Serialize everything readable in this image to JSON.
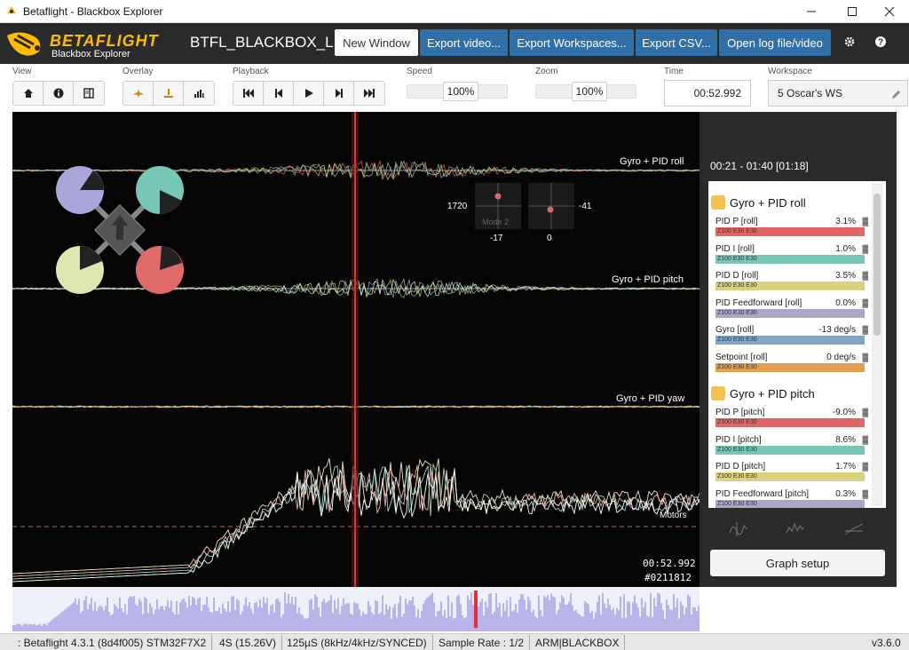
{
  "window": {
    "title": "Betaflight - Blackbox Explorer"
  },
  "brand": {
    "logo_text": "BETAFLIGHT",
    "logo_sub": "Blackbox Explorer",
    "accent": "#ffbb00"
  },
  "file": {
    "name": "BTFL_BLACKBOX_LO"
  },
  "header_buttons": [
    "New Window",
    "Export video...",
    "Export Workspaces...",
    "Export CSV...",
    "Open log file/video"
  ],
  "toolbar": {
    "view_label": "View",
    "overlay_label": "Overlay",
    "playback_label": "Playback",
    "speed_label": "Speed",
    "speed_value": "100%",
    "zoom_label": "Zoom",
    "zoom_value": "100%",
    "time_label": "Time",
    "time_value": "00:52.992",
    "workspace_label": "Workspace",
    "workspace_value": "5 Oscar's WS"
  },
  "graph": {
    "labels": [
      "Gyro + PID roll",
      "Gyro + PID pitch",
      "Gyro + PID yaw",
      "Motors"
    ],
    "sticks": {
      "left_x": "1720",
      "left_y": "-17",
      "right_x": "-41",
      "right_y": "0",
      "mode": "Mode 2"
    },
    "time": "00:52.992",
    "frame": "#0211812",
    "colors": {
      "roll": "#e06666",
      "pitch": "#76c7b7",
      "yaw": "#d9d17e",
      "setpoint": "#e0a050"
    }
  },
  "rightpanel": {
    "range": "00:21 - 01:40 [01:18]",
    "groups": [
      {
        "title": "Gyro + PID roll",
        "rows": [
          {
            "name": "PID P [roll]",
            "value": "3.1%",
            "bar": "Z100 E30 E30",
            "color": "#e06666"
          },
          {
            "name": "PID I [roll]",
            "value": "1.0%",
            "bar": "Z100 E30 E30",
            "color": "#76c7b7"
          },
          {
            "name": "PID D [roll]",
            "value": "3.5%",
            "bar": "Z100 E30 E30",
            "color": "#d9d17e"
          },
          {
            "name": "PID Feedforward [roll]",
            "value": "0.0%",
            "bar": "Z100 E30 E30",
            "color": "#a9a6c9"
          },
          {
            "name": "Gyro [roll]",
            "value": "-13 deg/s",
            "bar": "Z100 E30 E30",
            "color": "#7fa6c9"
          },
          {
            "name": "Setpoint [roll]",
            "value": "0 deg/s",
            "bar": "Z100 E30 E30",
            "color": "#e0a050"
          }
        ]
      },
      {
        "title": "Gyro + PID pitch",
        "rows": [
          {
            "name": "PID P [pitch]",
            "value": "-9.0%",
            "bar": "Z100 E30 E30",
            "color": "#e06666"
          },
          {
            "name": "PID I [pitch]",
            "value": "8.6%",
            "bar": "Z100 E30 E30",
            "color": "#76c7b7"
          },
          {
            "name": "PID D [pitch]",
            "value": "1.7%",
            "bar": "Z100 E30 E30",
            "color": "#d9d17e"
          },
          {
            "name": "PID Feedforward [pitch]",
            "value": "0.3%",
            "bar": "Z100 E30 E30",
            "color": "#a9a6c9"
          }
        ]
      }
    ],
    "graph_setup": "Graph setup"
  },
  "status": {
    "firmware": ": Betaflight 4.3.1 (8d4f005) STM32F7X2",
    "cells": "4S (15.26V)",
    "looptime": "125µS (8kHz/4kHz/SYNCED)",
    "sample_rate": "Sample Rate : 1/2",
    "flags": "ARM|BLACKBOX",
    "version": "v3.6.0"
  }
}
